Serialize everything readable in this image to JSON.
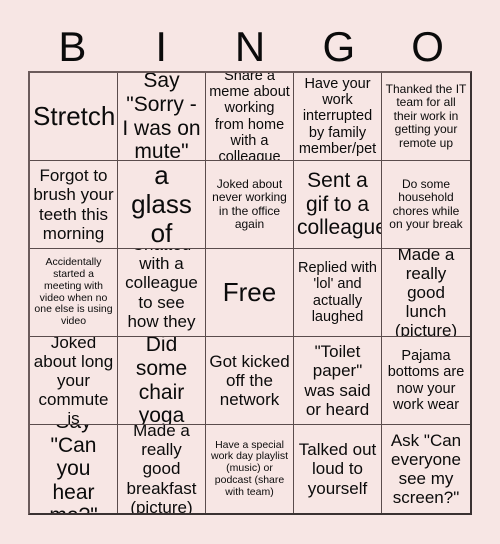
{
  "card": {
    "title_letters": [
      "B",
      "I",
      "N",
      "G",
      "O"
    ],
    "background_color": "#f7e6e4",
    "border_color": "#5a4c4c",
    "text_color": "#0b0b0b",
    "columns": 5,
    "rows": 5,
    "cells": [
      {
        "text": "Stretch!",
        "size": "xl"
      },
      {
        "text": "Say \"Sorry - I was on mute\"",
        "size": "lg"
      },
      {
        "text": "Share a meme about working from home with a colleague",
        "size": "sm"
      },
      {
        "text": "Have your work interrupted by family member/pet",
        "size": "sm"
      },
      {
        "text": "Thanked the IT team for all their work in getting your remote up",
        "size": "xs"
      },
      {
        "text": "Forgot to brush your teeth this morning",
        "size": "md"
      },
      {
        "text": "Drank a glass of water!",
        "size": "xl"
      },
      {
        "text": "Joked about never working in the office again",
        "size": "xs"
      },
      {
        "text": "Sent a gif to a colleague",
        "size": "lg"
      },
      {
        "text": "Do some household chores while on your break",
        "size": "xs"
      },
      {
        "text": "Accidentally started a meeting with video when no one else is using video",
        "size": "xxs"
      },
      {
        "text": "Chatted with a colleague to see how they are",
        "size": "md"
      },
      {
        "text": "Free",
        "size": "xl"
      },
      {
        "text": "Replied with 'lol' and actually laughed",
        "size": "sm"
      },
      {
        "text": "Made a really good lunch (picture)",
        "size": "md"
      },
      {
        "text": "Joked about long your commute is",
        "size": "md"
      },
      {
        "text": "Did some chair yoga",
        "size": "lg"
      },
      {
        "text": "Got kicked off the network",
        "size": "md"
      },
      {
        "text": "\"Toilet paper\" was said or heard",
        "size": "md"
      },
      {
        "text": "Pajama bottoms are now your work wear",
        "size": "sm"
      },
      {
        "text": "Say \"Can you hear me?\"",
        "size": "lg"
      },
      {
        "text": "Made a really good breakfast (picture)",
        "size": "md"
      },
      {
        "text": "Have a special work day playlist (music) or podcast (share with team)",
        "size": "xxs"
      },
      {
        "text": "Talked out loud to yourself",
        "size": "md"
      },
      {
        "text": "Ask \"Can everyone see my screen?\"",
        "size": "md"
      }
    ]
  }
}
